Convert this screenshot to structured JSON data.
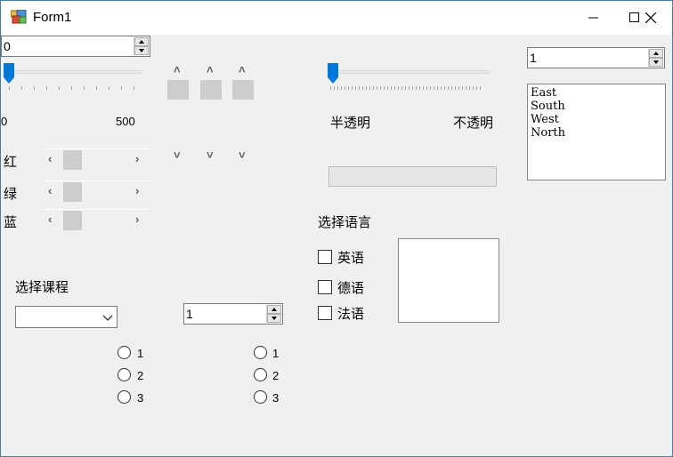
{
  "window": {
    "title": "Form1"
  },
  "titlebar_buttons": [
    {
      "name": "minimize-button",
      "glyph": "—"
    },
    {
      "name": "maximize-button",
      "glyph": "☐"
    },
    {
      "name": "close-button",
      "glyph": "✕"
    }
  ],
  "top_numeric": {
    "value": "0"
  },
  "trackbar_main": {
    "min_label": "0",
    "max_label": "500",
    "value": 0
  },
  "color_scrollbars": [
    {
      "label": "红",
      "value": 0
    },
    {
      "label": "绿",
      "value": 0
    },
    {
      "label": "蓝",
      "value": 0
    }
  ],
  "opacity": {
    "left_label": "半透明",
    "right_label": "不透明",
    "value": 0
  },
  "right_numeric": {
    "value": "1"
  },
  "listbox": {
    "items": [
      "East",
      "South",
      "West",
      "North"
    ]
  },
  "language": {
    "title": "选择语言",
    "options": [
      {
        "label": "英语",
        "checked": false
      },
      {
        "label": "德语",
        "checked": false
      },
      {
        "label": "法语",
        "checked": false
      }
    ]
  },
  "course": {
    "title": "选择课程",
    "combo_value": ""
  },
  "middle_numeric": {
    "value": "1"
  },
  "radios_left": [
    "1",
    "2",
    "3"
  ],
  "radios_right": [
    "1",
    "2",
    "3"
  ],
  "colors": {
    "accent": "#0078d7",
    "window_bg": "#f0f0f0",
    "border": "#3c7fb1"
  }
}
